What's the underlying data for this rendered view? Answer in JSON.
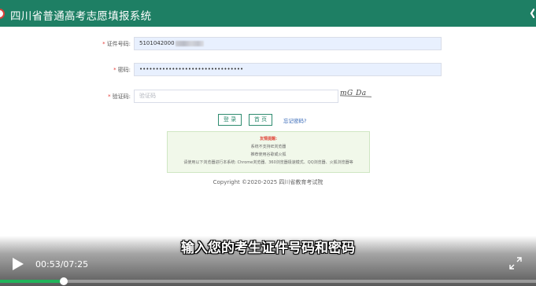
{
  "header": {
    "title": "四川省普通高考志愿填报系统",
    "bar_color": "#1e7f64"
  },
  "form": {
    "id_number": {
      "required_mark": "*",
      "label": "证件号码:",
      "value": "5101042000"
    },
    "password": {
      "required_mark": "*",
      "label": "密码:",
      "value": "••••••••••••••••••••••••••••••••"
    },
    "captcha": {
      "required_mark": "*",
      "label": "验证码:",
      "placeholder": "验证码",
      "image_text": "mG Da"
    }
  },
  "buttons": {
    "login": "登 录",
    "home": "首 页",
    "forgot": "忘记密码?"
  },
  "notice": {
    "title": "友情提醒:",
    "lines": [
      "系统不支持IE浏览器",
      "推荐使用谷歌或火狐",
      "请使用以下浏览器进行本系统: Chrome浏览器、360浏览器极速模式、QQ浏览器、火狐浏览器等"
    ]
  },
  "footer": {
    "copyright": "Copyright ©2020-2025 四川省教育考试院"
  },
  "player": {
    "subtitle": "输入您的考生证件号码和密码",
    "current_time": "00:53",
    "duration": "07:25",
    "time_text": "00:53/07:25",
    "progress": 0.119,
    "accent": "#21b35a",
    "icons": {
      "play": "play-icon",
      "fullscreen": "fullscreen-icon"
    }
  }
}
